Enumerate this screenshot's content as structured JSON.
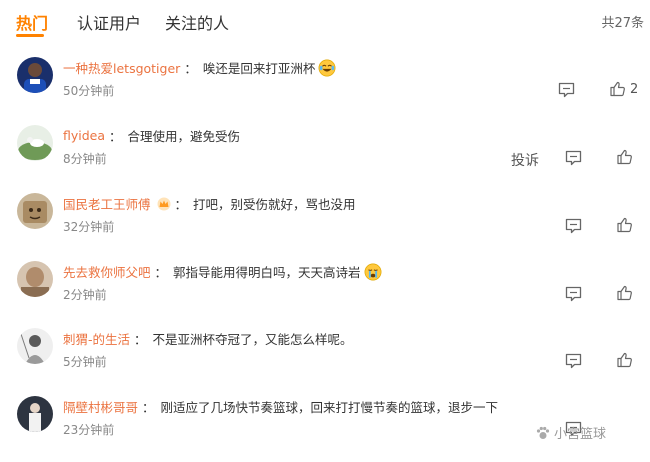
{
  "tabs": [
    {
      "label": "热门"
    },
    {
      "label": "认证用户"
    },
    {
      "label": "关注的人"
    }
  ],
  "total_count": "共27条",
  "comments": [
    {
      "user": "一种热爱letsgotiger",
      "sep": "：",
      "text": "唉还是回来打亚洲杯",
      "time": "50分钟前",
      "likes": "2",
      "emoji": "laugh-cry-icon"
    },
    {
      "user": "flyidea",
      "sep": "：",
      "text": "合理使用，避免受伤",
      "time": "8分钟前",
      "report": "投诉"
    },
    {
      "user": "国民老工王师傅",
      "sep": "：",
      "text": "打吧，别受伤就好，骂也没用",
      "time": "32分钟前",
      "badge": "vip-crown-icon"
    },
    {
      "user": "先去救你师父吧",
      "sep": "：",
      "text": "郭指导能用得明白吗，天天高诗岩",
      "time": "2分钟前",
      "emoji": "crying-face-icon"
    },
    {
      "user": "刺猬-的生活",
      "sep": "：",
      "text": "不是亚洲杯夺冠了，又能怎么样呢。",
      "time": "5分钟前"
    },
    {
      "user": "隔壁村彬哥哥",
      "sep": "：",
      "text": "刚适应了几场快节奏篮球，回来打打慢节奏的篮球，退步一下",
      "time": "23分钟前"
    }
  ],
  "watermark": "小宫篮球",
  "colors": {
    "accent": "#ff8200",
    "username": "#eb7340"
  }
}
